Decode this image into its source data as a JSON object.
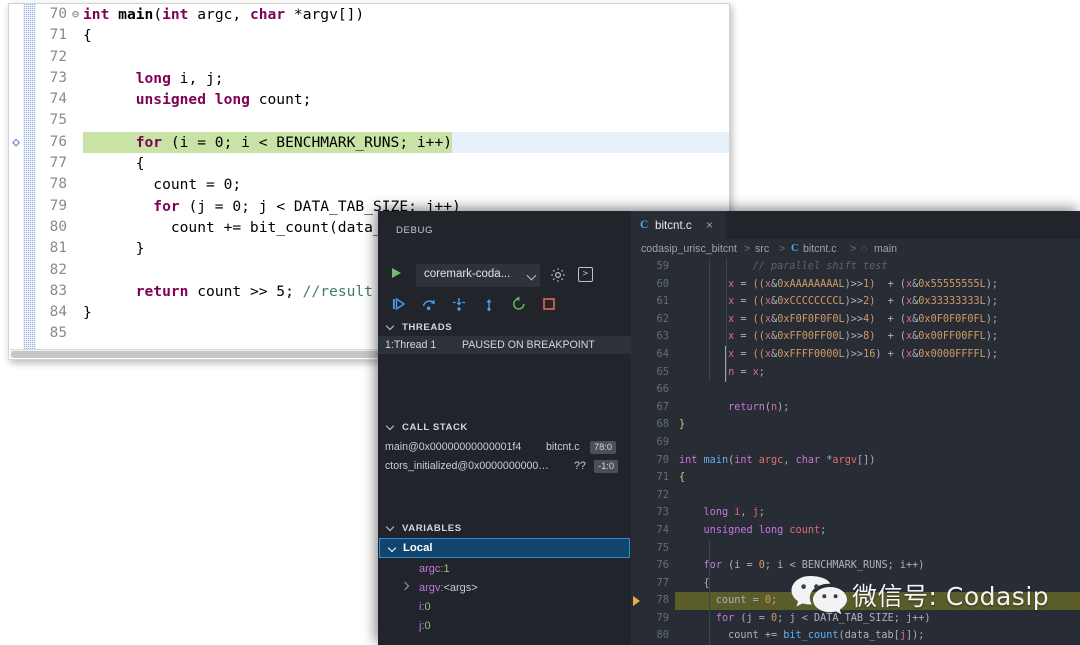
{
  "light_editor": {
    "name": "eclipse-editor",
    "lines": [
      {
        "no": "70",
        "fold": "⊖",
        "marker": "",
        "segs": [
          {
            "t": "int ",
            "c": "l-kw"
          },
          {
            "t": "main",
            "c": "bold"
          },
          {
            "t": "(",
            "c": ""
          },
          {
            "t": "int ",
            "c": "l-kw"
          },
          {
            "t": "argc, ",
            "c": ""
          },
          {
            "t": "char ",
            "c": "l-kw"
          },
          {
            "t": "*argv[])",
            "c": ""
          }
        ]
      },
      {
        "no": "71",
        "fold": "",
        "marker": "",
        "segs": [
          {
            "t": "{",
            "c": ""
          }
        ]
      },
      {
        "no": "72",
        "fold": "",
        "marker": "",
        "segs": []
      },
      {
        "no": "73",
        "fold": "",
        "marker": "",
        "segs": [
          {
            "t": "      ",
            "c": ""
          },
          {
            "t": "long ",
            "c": "l-kw"
          },
          {
            "t": "i, j;",
            "c": ""
          }
        ]
      },
      {
        "no": "74",
        "fold": "",
        "marker": "",
        "segs": [
          {
            "t": "      ",
            "c": ""
          },
          {
            "t": "unsigned long ",
            "c": "l-kw"
          },
          {
            "t": "count;",
            "c": ""
          }
        ]
      },
      {
        "no": "75",
        "fold": "",
        "marker": "",
        "segs": []
      },
      {
        "no": "76",
        "fold": "",
        "marker": "◇",
        "highlight": true,
        "segs": [
          {
            "t": "      ",
            "c": ""
          },
          {
            "t": "for ",
            "c": "l-kw"
          },
          {
            "t": "(i = 0; i < BENCHMARK_RUNS; i++)",
            "c": ""
          }
        ]
      },
      {
        "no": "77",
        "fold": "",
        "marker": "",
        "segs": [
          {
            "t": "      {",
            "c": ""
          }
        ]
      },
      {
        "no": "78",
        "fold": "",
        "marker": "",
        "segs": [
          {
            "t": "        count = 0;",
            "c": ""
          }
        ]
      },
      {
        "no": "79",
        "fold": "",
        "marker": "",
        "segs": [
          {
            "t": "        ",
            "c": ""
          },
          {
            "t": "for ",
            "c": "l-kw"
          },
          {
            "t": "(j = 0; j < DATA_TAB_SIZE; j++)",
            "c": ""
          }
        ]
      },
      {
        "no": "80",
        "fold": "",
        "marker": "",
        "segs": [
          {
            "t": "          count += bit_count(data_tab[j]);",
            "c": ""
          }
        ]
      },
      {
        "no": "81",
        "fold": "",
        "marker": "",
        "segs": [
          {
            "t": "      }",
            "c": ""
          }
        ]
      },
      {
        "no": "82",
        "fold": "",
        "marker": "",
        "segs": []
      },
      {
        "no": "83",
        "fold": "",
        "marker": "",
        "segs": [
          {
            "t": "      ",
            "c": ""
          },
          {
            "t": "return ",
            "c": "l-kw"
          },
          {
            "t": "count >> 5; ",
            "c": ""
          },
          {
            "t": "//result of benchmark",
            "c": "l-cm"
          }
        ]
      },
      {
        "no": "84",
        "fold": "",
        "marker": "",
        "segs": [
          {
            "t": "}",
            "c": ""
          }
        ]
      },
      {
        "no": "85",
        "fold": "",
        "marker": "",
        "segs": []
      }
    ]
  },
  "vscode": {
    "debug_panel": {
      "title": "DEBUG",
      "configuration": "coremark-coda...",
      "toolbar_icons": [
        "continue-icon",
        "step-over-icon",
        "step-into-icon",
        "step-out-icon",
        "restart-icon",
        "stop-icon"
      ],
      "threads": {
        "header": "THREADS",
        "rows": [
          {
            "name": "1:Thread 1",
            "state": "PAUSED ON BREAKPOINT"
          }
        ]
      },
      "call_stack": {
        "header": "CALL STACK",
        "rows": [
          {
            "fn": "main@0x00000000000001f4",
            "file": "bitcnt.c",
            "badge": "78:0"
          },
          {
            "fn": "ctors_initialized@0x0000000000…",
            "file": "??",
            "badge": "-1:0"
          }
        ]
      },
      "variables": {
        "header": "VARIABLES",
        "scope": "Local",
        "rows": [
          {
            "name": "argc:",
            "value": "1",
            "kind": "num",
            "expandable": false
          },
          {
            "name": "argv:",
            "value": "<args>",
            "kind": "str",
            "expandable": true
          },
          {
            "name": "i:",
            "value": "0",
            "kind": "num",
            "expandable": false
          },
          {
            "name": "j:",
            "value": "0",
            "kind": "num",
            "expandable": false
          }
        ]
      }
    },
    "editor": {
      "tab": {
        "icon": "C",
        "label": "bitcnt.c",
        "close": "×"
      },
      "breadcrumb": [
        "codasip_urisc_bitcnt",
        "src",
        "bitcnt.c",
        "main"
      ],
      "lines": [
        {
          "no": "59",
          "segs": [
            {
              "t": "            ",
              "c": ""
            },
            {
              "t": "// parallel shift test",
              "c": "k-cm"
            }
          ]
        },
        {
          "no": "60",
          "segs": [
            {
              "t": "        ",
              "c": ""
            },
            {
              "t": "x",
              "c": "k-var"
            },
            {
              "t": " = ",
              "c": "k-plain"
            },
            {
              "t": "((",
              "c": "k-brace"
            },
            {
              "t": "x",
              "c": "k-var"
            },
            {
              "t": "&",
              "c": "k-plain"
            },
            {
              "t": "0xAAAAAAAAL",
              "c": "k-num"
            },
            {
              "t": ")>>",
              "c": "k-plain"
            },
            {
              "t": "1",
              "c": "k-num"
            },
            {
              "t": ")",
              "c": "k-brace"
            },
            {
              "t": "  + (",
              "c": "k-plain"
            },
            {
              "t": "x",
              "c": "k-var"
            },
            {
              "t": "&",
              "c": "k-plain"
            },
            {
              "t": "0x55555555L",
              "c": "k-num"
            },
            {
              "t": ");",
              "c": "k-plain"
            }
          ]
        },
        {
          "no": "61",
          "segs": [
            {
              "t": "        ",
              "c": ""
            },
            {
              "t": "x",
              "c": "k-var"
            },
            {
              "t": " = ",
              "c": "k-plain"
            },
            {
              "t": "((",
              "c": "k-brace"
            },
            {
              "t": "x",
              "c": "k-var"
            },
            {
              "t": "&",
              "c": "k-plain"
            },
            {
              "t": "0xCCCCCCCCL",
              "c": "k-num"
            },
            {
              "t": ")>>",
              "c": "k-plain"
            },
            {
              "t": "2",
              "c": "k-num"
            },
            {
              "t": ")",
              "c": "k-brace"
            },
            {
              "t": "  + (",
              "c": "k-plain"
            },
            {
              "t": "x",
              "c": "k-var"
            },
            {
              "t": "&",
              "c": "k-plain"
            },
            {
              "t": "0x33333333L",
              "c": "k-num"
            },
            {
              "t": ");",
              "c": "k-plain"
            }
          ]
        },
        {
          "no": "62",
          "segs": [
            {
              "t": "        ",
              "c": ""
            },
            {
              "t": "x",
              "c": "k-var"
            },
            {
              "t": " = ",
              "c": "k-plain"
            },
            {
              "t": "((",
              "c": "k-brace"
            },
            {
              "t": "x",
              "c": "k-var"
            },
            {
              "t": "&",
              "c": "k-plain"
            },
            {
              "t": "0xF0F0F0F0L",
              "c": "k-num"
            },
            {
              "t": ")>>",
              "c": "k-plain"
            },
            {
              "t": "4",
              "c": "k-num"
            },
            {
              "t": ")",
              "c": "k-brace"
            },
            {
              "t": "  + (",
              "c": "k-plain"
            },
            {
              "t": "x",
              "c": "k-var"
            },
            {
              "t": "&",
              "c": "k-plain"
            },
            {
              "t": "0x0F0F0F0FL",
              "c": "k-num"
            },
            {
              "t": ");",
              "c": "k-plain"
            }
          ]
        },
        {
          "no": "63",
          "segs": [
            {
              "t": "        ",
              "c": ""
            },
            {
              "t": "x",
              "c": "k-var"
            },
            {
              "t": " = ",
              "c": "k-plain"
            },
            {
              "t": "((",
              "c": "k-brace"
            },
            {
              "t": "x",
              "c": "k-var"
            },
            {
              "t": "&",
              "c": "k-plain"
            },
            {
              "t": "0xFF00FF00L",
              "c": "k-num"
            },
            {
              "t": ")>>",
              "c": "k-plain"
            },
            {
              "t": "8",
              "c": "k-num"
            },
            {
              "t": ")",
              "c": "k-brace"
            },
            {
              "t": "  + (",
              "c": "k-plain"
            },
            {
              "t": "x",
              "c": "k-var"
            },
            {
              "t": "&",
              "c": "k-plain"
            },
            {
              "t": "0x00FF00FFL",
              "c": "k-num"
            },
            {
              "t": ");",
              "c": "k-plain"
            }
          ]
        },
        {
          "no": "64",
          "segs": [
            {
              "t": "        ",
              "c": ""
            },
            {
              "t": "x",
              "c": "k-var"
            },
            {
              "t": " = ",
              "c": "k-plain"
            },
            {
              "t": "((",
              "c": "k-brace"
            },
            {
              "t": "x",
              "c": "k-var"
            },
            {
              "t": "&",
              "c": "k-plain"
            },
            {
              "t": "0xFFFF0000L",
              "c": "k-num"
            },
            {
              "t": ")>>",
              "c": "k-plain"
            },
            {
              "t": "16",
              "c": "k-num"
            },
            {
              "t": ") + (",
              "c": "k-plain"
            },
            {
              "t": "x",
              "c": "k-var"
            },
            {
              "t": "&",
              "c": "k-plain"
            },
            {
              "t": "0x0000FFFFL",
              "c": "k-num"
            },
            {
              "t": ");",
              "c": "k-plain"
            }
          ]
        },
        {
          "no": "65",
          "segs": [
            {
              "t": "        ",
              "c": ""
            },
            {
              "t": "n",
              "c": "k-var"
            },
            {
              "t": " = ",
              "c": "k-plain"
            },
            {
              "t": "x",
              "c": "k-var"
            },
            {
              "t": ";",
              "c": "k-plain"
            }
          ]
        },
        {
          "no": "66",
          "segs": []
        },
        {
          "no": "67",
          "segs": [
            {
              "t": "        ",
              "c": ""
            },
            {
              "t": "return",
              "c": "k-kw"
            },
            {
              "t": "(",
              "c": "k-plain"
            },
            {
              "t": "n",
              "c": "k-var"
            },
            {
              "t": ");",
              "c": "k-plain"
            }
          ]
        },
        {
          "no": "68",
          "segs": [
            {
              "t": "}",
              "c": "k-yellow"
            }
          ]
        },
        {
          "no": "69",
          "segs": []
        },
        {
          "no": "70",
          "segs": [
            {
              "t": "int ",
              "c": "k-kw"
            },
            {
              "t": "main",
              "c": "k-fn"
            },
            {
              "t": "(",
              "c": "k-plain"
            },
            {
              "t": "int ",
              "c": "k-kw"
            },
            {
              "t": "argc",
              "c": "k-var"
            },
            {
              "t": ", ",
              "c": "k-plain"
            },
            {
              "t": "char ",
              "c": "k-kw"
            },
            {
              "t": "*",
              "c": "k-plain"
            },
            {
              "t": "argv",
              "c": "k-var"
            },
            {
              "t": "[])",
              "c": "k-plain"
            }
          ]
        },
        {
          "no": "71",
          "segs": [
            {
              "t": "{",
              "c": "k-yellow"
            }
          ]
        },
        {
          "no": "72",
          "segs": []
        },
        {
          "no": "73",
          "segs": [
            {
              "t": "    ",
              "c": ""
            },
            {
              "t": "long ",
              "c": "k-kw"
            },
            {
              "t": "i",
              "c": "k-var"
            },
            {
              "t": ", ",
              "c": "k-plain"
            },
            {
              "t": "j",
              "c": "k-var"
            },
            {
              "t": ";",
              "c": "k-plain"
            }
          ]
        },
        {
          "no": "74",
          "segs": [
            {
              "t": "    ",
              "c": ""
            },
            {
              "t": "unsigned long ",
              "c": "k-kw"
            },
            {
              "t": "count",
              "c": "k-var"
            },
            {
              "t": ";",
              "c": "k-plain"
            }
          ]
        },
        {
          "no": "75",
          "segs": []
        },
        {
          "no": "76",
          "segs": [
            {
              "t": "    ",
              "c": ""
            },
            {
              "t": "for ",
              "c": "k-kw"
            },
            {
              "t": "(i = ",
              "c": "k-plain"
            },
            {
              "t": "0",
              "c": "k-num"
            },
            {
              "t": "; i < ",
              "c": "k-plain"
            },
            {
              "t": "BENCHMARK_RUNS",
              "c": "k-plain"
            },
            {
              "t": "; i++)",
              "c": "k-plain"
            }
          ]
        },
        {
          "no": "77",
          "segs": [
            {
              "t": "    {",
              "c": "k-plain"
            }
          ]
        },
        {
          "no": "78",
          "breakpoint": true,
          "current": true,
          "segs": [
            {
              "t": "      count = ",
              "c": "k-plain"
            },
            {
              "t": "0",
              "c": "k-num"
            },
            {
              "t": ";",
              "c": "k-plain"
            }
          ]
        },
        {
          "no": "79",
          "segs": [
            {
              "t": "      ",
              "c": ""
            },
            {
              "t": "for ",
              "c": "k-kw"
            },
            {
              "t": "(j = ",
              "c": "k-plain"
            },
            {
              "t": "0",
              "c": "k-num"
            },
            {
              "t": "; j < ",
              "c": "k-plain"
            },
            {
              "t": "DATA_TAB_SIZE",
              "c": "k-plain"
            },
            {
              "t": "; j++)",
              "c": "k-plain"
            }
          ]
        },
        {
          "no": "80",
          "segs": [
            {
              "t": "        count += ",
              "c": "k-plain"
            },
            {
              "t": "bit_count",
              "c": "k-fn"
            },
            {
              "t": "(data_tab[",
              "c": "k-plain"
            },
            {
              "t": "j",
              "c": "k-var"
            },
            {
              "t": "]);",
              "c": "k-plain"
            }
          ]
        }
      ]
    }
  },
  "watermark": {
    "icon": "wechat-logo",
    "text": "微信号: Codasip"
  },
  "colors": {
    "light_highlight": "#c9e2a6",
    "dark_current_line": "#5a5c2a",
    "accent_blue": "#2d8fd5",
    "editor_bg": "#282c34",
    "sidebar_bg": "#21252b"
  }
}
